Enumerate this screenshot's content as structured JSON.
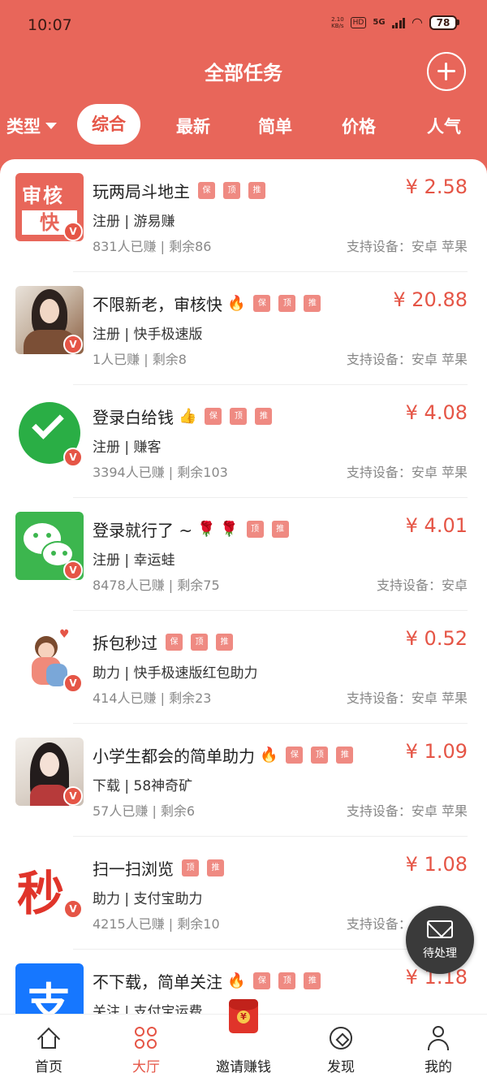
{
  "status_bar": {
    "time": "10:07",
    "speed_top": "2.10",
    "speed_bottom": "KB/s",
    "hd_label": "HD",
    "net_label": "5G",
    "battery": "78"
  },
  "header": {
    "title": "全部任务",
    "add_icon": "plus-circle-icon"
  },
  "tabs": {
    "type_label": "类型",
    "items": [
      {
        "label": "综合",
        "active": true
      },
      {
        "label": "最新"
      },
      {
        "label": "简单"
      },
      {
        "label": "价格"
      },
      {
        "label": "人气"
      }
    ]
  },
  "tag_labels": {
    "bao": "保",
    "ding": "顶",
    "tui": "推"
  },
  "badge_label": "V",
  "tasks": [
    {
      "title": "玩两局斗地主",
      "emoji": "",
      "price": "¥ 2.58",
      "category": "注册 | 游易赚",
      "stats": "831人已赚 |  剩余86",
      "devices": "支持设备：安卓 苹果",
      "thumb_top": "审核",
      "thumb_bottom": "快"
    },
    {
      "title": "不限新老，审核快",
      "emoji": "🔥",
      "price": "¥ 20.88",
      "category": "注册 | 快手极速版",
      "stats": "1人已赚 |  剩余8",
      "devices": "支持设备：安卓 苹果"
    },
    {
      "title": "登录白给钱",
      "emoji": "👍",
      "price": "¥ 4.08",
      "category": "注册 | 赚客",
      "stats": "3394人已赚 |  剩余103",
      "devices": "支持设备：安卓 苹果"
    },
    {
      "title": "登录就行了 ~",
      "emoji": "🌹 🌹",
      "price": "¥ 4.01",
      "category": "注册 | 幸运蛙",
      "stats": "8478人已赚 |  剩余75",
      "devices": "支持设备：安卓"
    },
    {
      "title": "拆包秒过",
      "emoji": "",
      "price": "¥ 0.52",
      "category": "助力 | 快手极速版红包助力",
      "stats": "414人已赚 |  剩余23",
      "devices": "支持设备：安卓 苹果"
    },
    {
      "title": "小学生都会的简单助力",
      "emoji": "🔥",
      "price": "¥ 1.09",
      "category": "下载 | 58神奇矿",
      "stats": "57人已赚 |  剩余6",
      "devices": "支持设备：安卓 苹果"
    },
    {
      "title": "扫一扫浏览",
      "emoji": "",
      "price": "¥ 1.08",
      "category": "助力 | 支付宝助力",
      "stats": "4215人已赚 |  剩余10",
      "devices": "支持设备：安卓 苹果",
      "thumb_char": "秒"
    },
    {
      "title": "不下载，简单关注",
      "emoji": "🔥",
      "price": "¥ 1.18",
      "category": "关注 | 支付宝运费",
      "stats": "",
      "devices": "",
      "thumb_char": "支"
    }
  ],
  "fab": {
    "label": "待处理",
    "icon": "envelope-icon"
  },
  "bottom_nav": {
    "home": "首页",
    "hall": "大厅",
    "invite": "邀请赚钱",
    "discover": "发现",
    "me": "我的"
  },
  "colors": {
    "accent": "#e8665a",
    "price": "#e55546",
    "tag": "#ef8a82"
  }
}
